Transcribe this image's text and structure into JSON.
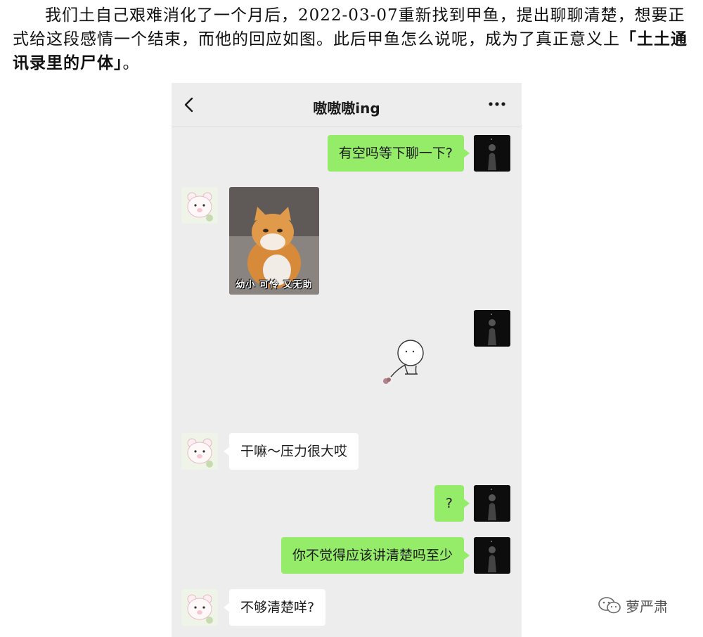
{
  "article": {
    "text_before": "我们土自己艰难消化了一个月后，2022-03-07重新找到甲鱼，提出聊聊清楚，想要正式给这段感情一个结束，而他的回应如图。此后甲鱼怎么说呢，成为了真正意义上",
    "text_bold": "「土土通讯录里的尸体」",
    "text_after": "。"
  },
  "chat": {
    "title": "嗷嗷嗷ing",
    "icons": {
      "back": "chevron-left-icon",
      "more": "more-dots-icon"
    },
    "messages": [
      {
        "side": "out",
        "type": "text",
        "text": "有空吗等下聊一下?"
      },
      {
        "side": "in",
        "type": "sticker",
        "caption": "幼小 可怜 又无助"
      },
      {
        "side": "out",
        "type": "sticker",
        "sticker": "doodle-figure"
      },
      {
        "side": "in",
        "type": "text",
        "text": "干嘛～压力很大哎"
      },
      {
        "side": "out",
        "type": "text",
        "text": "?"
      },
      {
        "side": "out",
        "type": "text",
        "text": "你不觉得应该讲清楚吗至少"
      },
      {
        "side": "in",
        "type": "text",
        "text": "不够清楚咩?"
      }
    ],
    "colors": {
      "outgoing_bubble": "#95ec69",
      "incoming_bubble": "#ffffff",
      "background": "#ededed"
    }
  },
  "watermark": {
    "text": "萝严肃",
    "icon": "wechat-icon"
  }
}
